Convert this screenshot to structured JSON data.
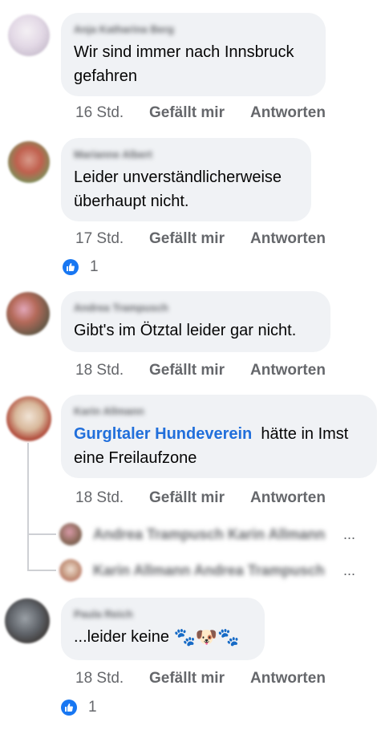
{
  "comments": [
    {
      "author": "Anja Katharina Berg",
      "text": "Wir sind immer nach Innsbruck gefahren",
      "time": "16 Std.",
      "like": "Gefällt mir",
      "reply": "Antworten"
    },
    {
      "author": "Marianne Albert",
      "text": "Leider unverständlicherweise überhaupt nicht.",
      "time": "17 Std.",
      "like": "Gefällt mir",
      "reply": "Antworten",
      "reactions": "1"
    },
    {
      "author": "Andrea Trampusch",
      "text": "Gibt's im Ötztal leider gar nicht.",
      "time": "18 Std.",
      "like": "Gefällt mir",
      "reply": "Antworten"
    },
    {
      "author": "Karin Allmann",
      "mention": "Gurgltaler Hundeverein",
      "text": "hätte in Imst eine Freilaufzone",
      "time": "18 Std.",
      "like": "Gefällt mir",
      "reply": "Antworten",
      "replies": [
        {
          "text": "Andrea Trampusch Karin Allmann",
          "ellipsis": "..."
        },
        {
          "text": "Karin Allmann Andrea Trampusch",
          "ellipsis": "..."
        }
      ]
    },
    {
      "author": "Paula Reich",
      "text": "...leider keine",
      "emojis": "🐾🐶🐾",
      "time": "18 Std.",
      "like": "Gefällt mir",
      "reply": "Antworten",
      "reactions": "1"
    }
  ],
  "colors": {
    "bubble": "#f0f2f5",
    "meta": "#65676b",
    "mention": "#216fdb",
    "like_blue": "#1877f2"
  },
  "icons": [
    "thumbs-up-icon",
    "avatar"
  ]
}
